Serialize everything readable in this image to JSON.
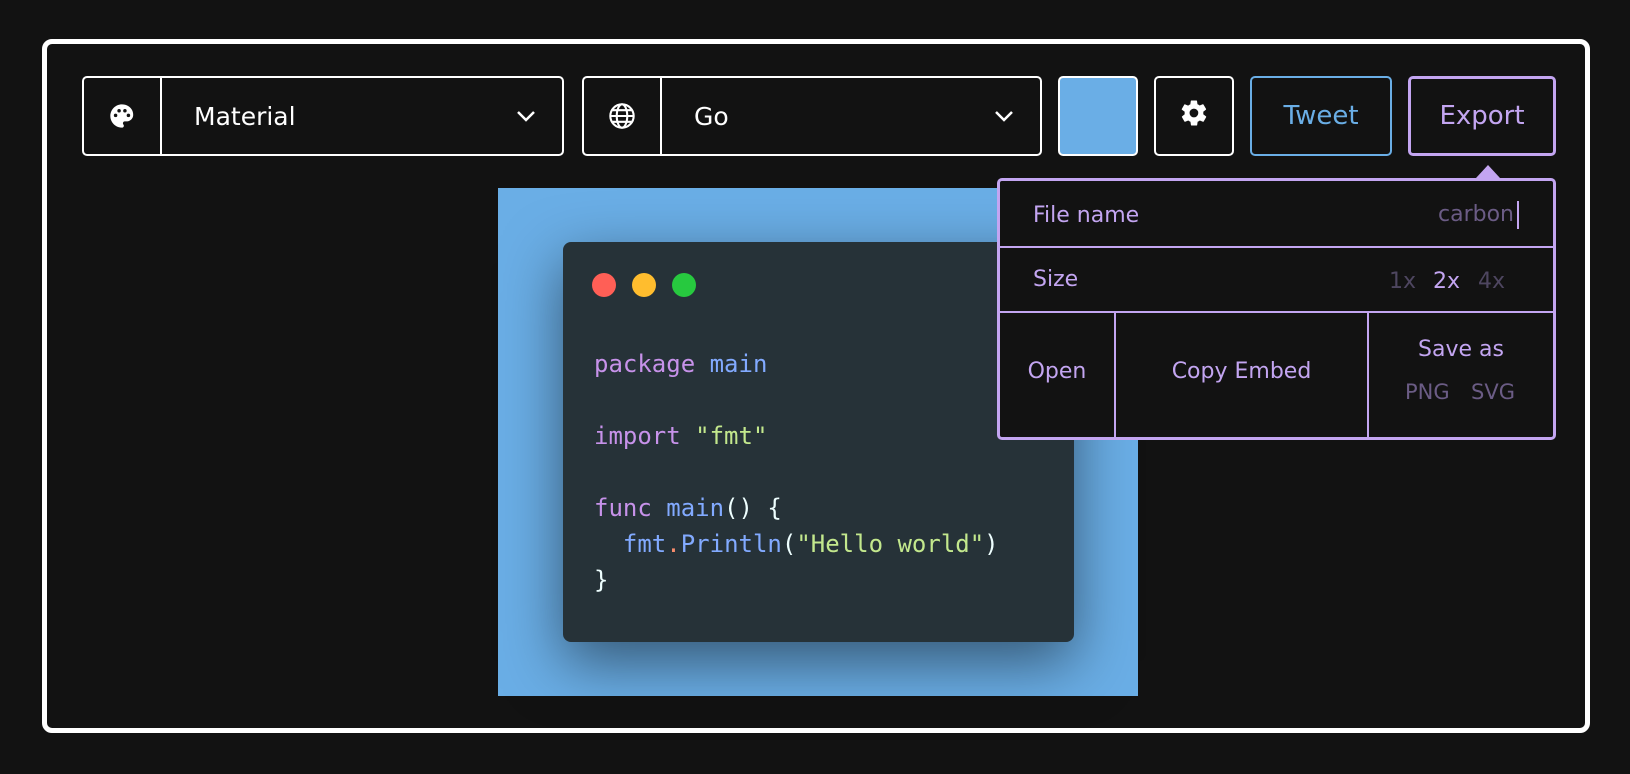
{
  "toolbar": {
    "theme_label": "Material",
    "language_label": "Go",
    "background_color": "#6aaee6",
    "tweet_label": "Tweet",
    "export_label": "Export"
  },
  "colors": {
    "accent_purple": "#c3a5f1",
    "tweet_blue": "#6aaee6",
    "window_bg": "#263238"
  },
  "icons": [
    "palette-icon",
    "globe-icon",
    "chevron-down-icon",
    "gear-icon"
  ],
  "code": {
    "line1_kw": "package",
    "line1_name": "main",
    "line2_kw": "import",
    "line2_str": "\"fmt\"",
    "line3_kw": "func",
    "line3_fn": "main",
    "line3_rest": "() {",
    "line4_pkg": "fmt",
    "line4_dot": ".",
    "line4_fn": "Println",
    "line4_open": "(",
    "line4_str": "\"Hello world\"",
    "line4_close": ")",
    "line5": "}"
  },
  "export_panel": {
    "file_name_label": "File name",
    "file_name_value": "carbon",
    "size_label": "Size",
    "sizes": [
      "1x",
      "2x",
      "4x"
    ],
    "selected_size": "2x",
    "open_label": "Open",
    "copy_embed_label": "Copy Embed",
    "save_as_label": "Save as",
    "png_label": "PNG",
    "svg_label": "SVG"
  }
}
